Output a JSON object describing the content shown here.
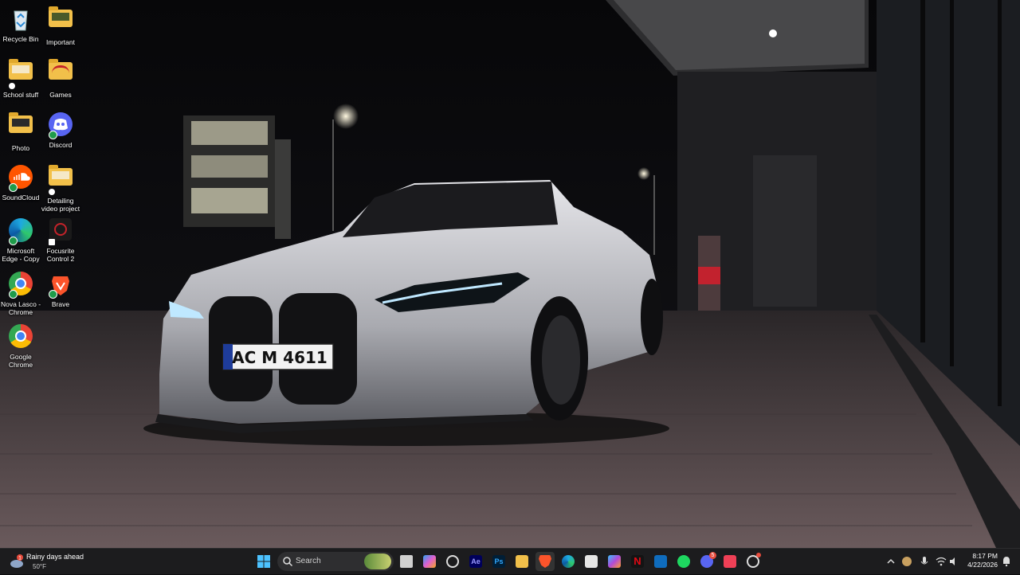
{
  "desktop": {
    "icons": [
      {
        "label": "Recycle Bin",
        "icon": "recycle-bin-icon"
      },
      {
        "label": "Important",
        "icon": "folder-icon"
      },
      {
        "label": "School stuff",
        "icon": "folder-icon"
      },
      {
        "label": "Games",
        "icon": "folder-icon"
      },
      {
        "label": "Photo",
        "icon": "folder-icon"
      },
      {
        "label": "Discord",
        "icon": "discord-icon"
      },
      {
        "label": "SoundCloud",
        "icon": "soundcloud-icon"
      },
      {
        "label": "Detailing video project",
        "icon": "folder-icon"
      },
      {
        "label": "Microsoft Edge - Copy",
        "icon": "edge-icon"
      },
      {
        "label": "Focusrite Control 2",
        "icon": "focusrite-icon"
      },
      {
        "label": "Nova Lasco - Chrome",
        "icon": "chrome-icon"
      },
      {
        "label": "Brave",
        "icon": "brave-icon"
      },
      {
        "label": "Google Chrome",
        "icon": "chrome-icon"
      }
    ],
    "wallpaper": {
      "plate": "AC M 4611"
    }
  },
  "taskbar": {
    "weather": {
      "title": "Rainy days ahead",
      "temp": "50°F",
      "badge": "1"
    },
    "search_placeholder": "Search",
    "apps": [
      "windows-start-icon",
      "search-icon",
      "widgets-icon",
      "file-explorer-icon",
      "copilot-icon",
      "chatgpt-icon",
      "after-effects-icon",
      "photoshop-icon",
      "folder-icon",
      "brave-icon",
      "edge-icon",
      "store-icon",
      "m365-icon",
      "netflix-icon",
      "outlook-icon",
      "spotify-icon",
      "discord-icon",
      "pocket-icon",
      "chatgpt-app-icon"
    ],
    "app_labels": {
      "ae": "Ae",
      "ps": "Ps"
    },
    "discord_badge": "5",
    "clock": {
      "time": "8:17 PM",
      "date": "4/22/2026"
    }
  },
  "colors": {
    "taskbar": "#1c1c1e",
    "accent": "#4cc2ff",
    "folder": "#f2c04a"
  }
}
